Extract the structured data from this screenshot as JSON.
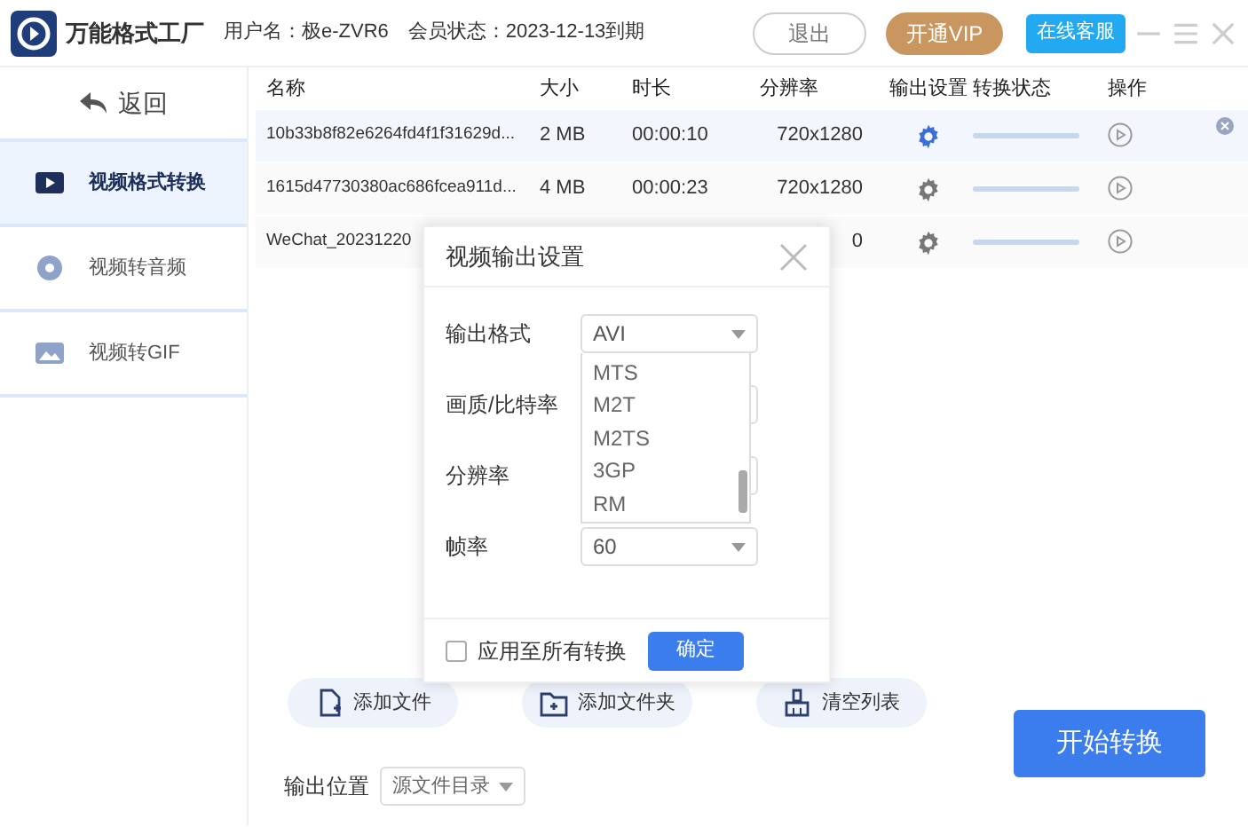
{
  "app": {
    "title": "万能格式工厂",
    "user": "用户名：极e-ZVR6",
    "membership": "会员状态：2023-12-13到期",
    "logout": "退出",
    "vip": "开通VIP",
    "service": "在线客服"
  },
  "sidebar": {
    "back": "返回",
    "items": [
      {
        "label": "视频格式转换",
        "selected": true
      },
      {
        "label": "视频转音频",
        "selected": false
      },
      {
        "label": "视频转GIF",
        "selected": false
      }
    ]
  },
  "table": {
    "columns": [
      "名称",
      "大小",
      "时长",
      "分辨率",
      "输出设置",
      "转换状态",
      "操作"
    ],
    "rows": [
      {
        "name": "10b33b8f82e6264fd4f1f31629d...",
        "size": "2 MB",
        "duration": "00:00:10",
        "resolution": "720x1280",
        "selected": true
      },
      {
        "name": "1615d47730380ac686fcea911d...",
        "size": "4 MB",
        "duration": "00:00:23",
        "resolution": "720x1280",
        "selected": false
      },
      {
        "name": "WeChat_20231220",
        "resolution": "0",
        "selected": false
      }
    ]
  },
  "dialog": {
    "title": "视频输出设置",
    "fields": [
      {
        "label": "输出格式",
        "value": "AVI"
      },
      {
        "label": "画质/比特率"
      },
      {
        "label": "分辨率"
      },
      {
        "label": "帧率",
        "value": "60"
      }
    ],
    "format_options": [
      "MTS",
      "M2T",
      "M2TS",
      "3GP",
      "RM"
    ],
    "apply_all": {
      "label": "应用至所有转换",
      "checked": false
    },
    "ok": "确定"
  },
  "actions": [
    "添加文件",
    "添加文件夹",
    "清空列表"
  ],
  "output": {
    "label": "输出位置",
    "value": "源文件目录"
  },
  "start": "开始转换"
}
